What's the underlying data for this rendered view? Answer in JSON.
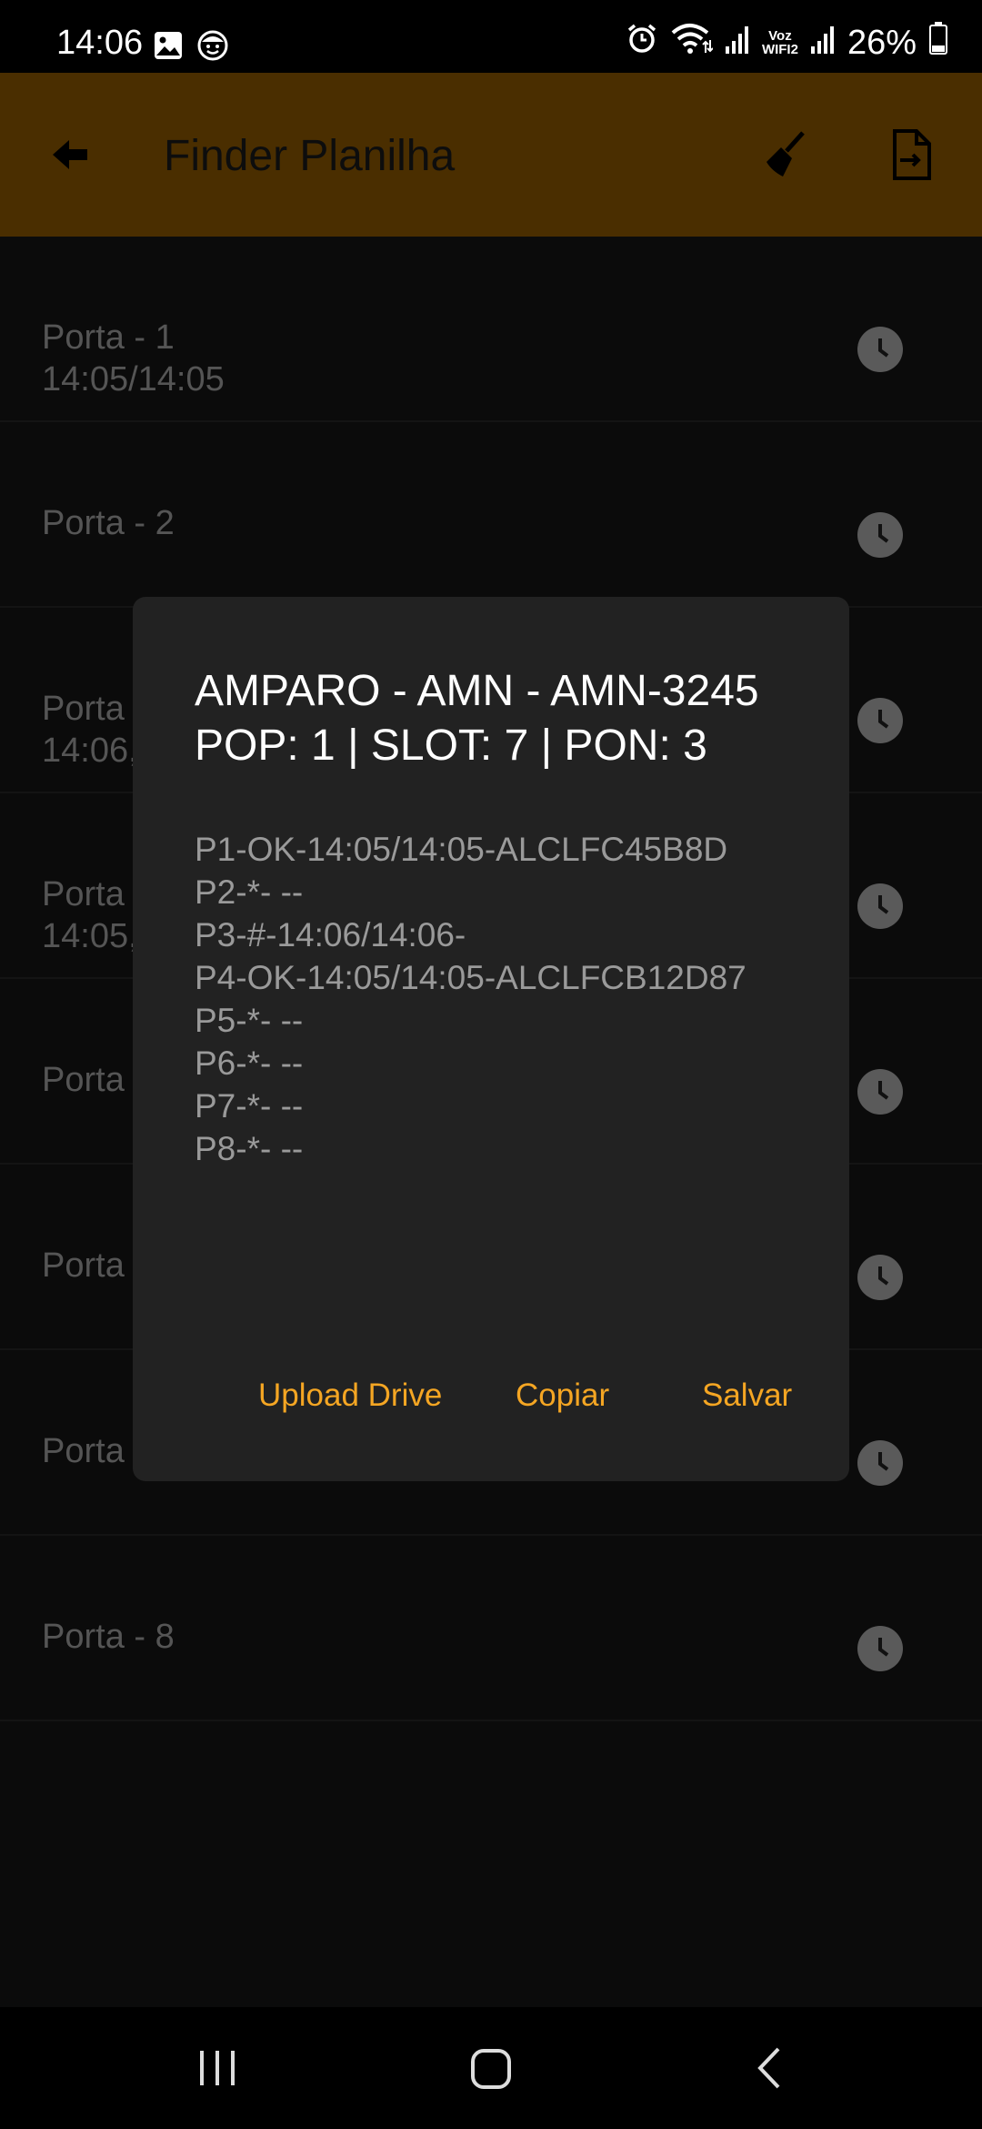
{
  "status_bar": {
    "time": "14:06",
    "left_icons": [
      "image-icon",
      "face-icon"
    ],
    "right_icons": [
      "alarm-icon",
      "wifi-icon",
      "signal-icon",
      "voz-wifi-icon",
      "signal-icon"
    ],
    "voz_label_1": "Voz",
    "voz_label_2": "WIFI2",
    "battery": "26%"
  },
  "app_bar": {
    "title": "Finder Planilha",
    "background": "#4a2e00"
  },
  "list": {
    "items": [
      {
        "title": "Porta - 1",
        "subtitle": "14:05/14:05"
      },
      {
        "title": "Porta - 2",
        "subtitle": ""
      },
      {
        "title": "Porta",
        "subtitle": "14:06,"
      },
      {
        "title": "Porta",
        "subtitle": "14:05,"
      },
      {
        "title": "Porta",
        "subtitle": ""
      },
      {
        "title": "Porta",
        "subtitle": ""
      },
      {
        "title": "Porta",
        "subtitle": ""
      },
      {
        "title": "Porta - 8",
        "subtitle": ""
      }
    ]
  },
  "dialog": {
    "title_line1": "AMPARO - AMN - AMN-3245",
    "title_line2": "POP: 1 | SLOT: 7 | PON: 3",
    "lines": [
      "P1-OK-14:05/14:05-ALCLFC45B8D",
      "P2-*- --",
      "P3-#-14:06/14:06-",
      "P4-OK-14:05/14:05-ALCLFCB12D87",
      "P5-*- --",
      "P6-*- --",
      "P7-*- --",
      "P8-*- --"
    ],
    "actions": {
      "upload": "Upload Drive",
      "copy": "Copiar",
      "save": "Salvar"
    },
    "accent": "#f5a623"
  }
}
